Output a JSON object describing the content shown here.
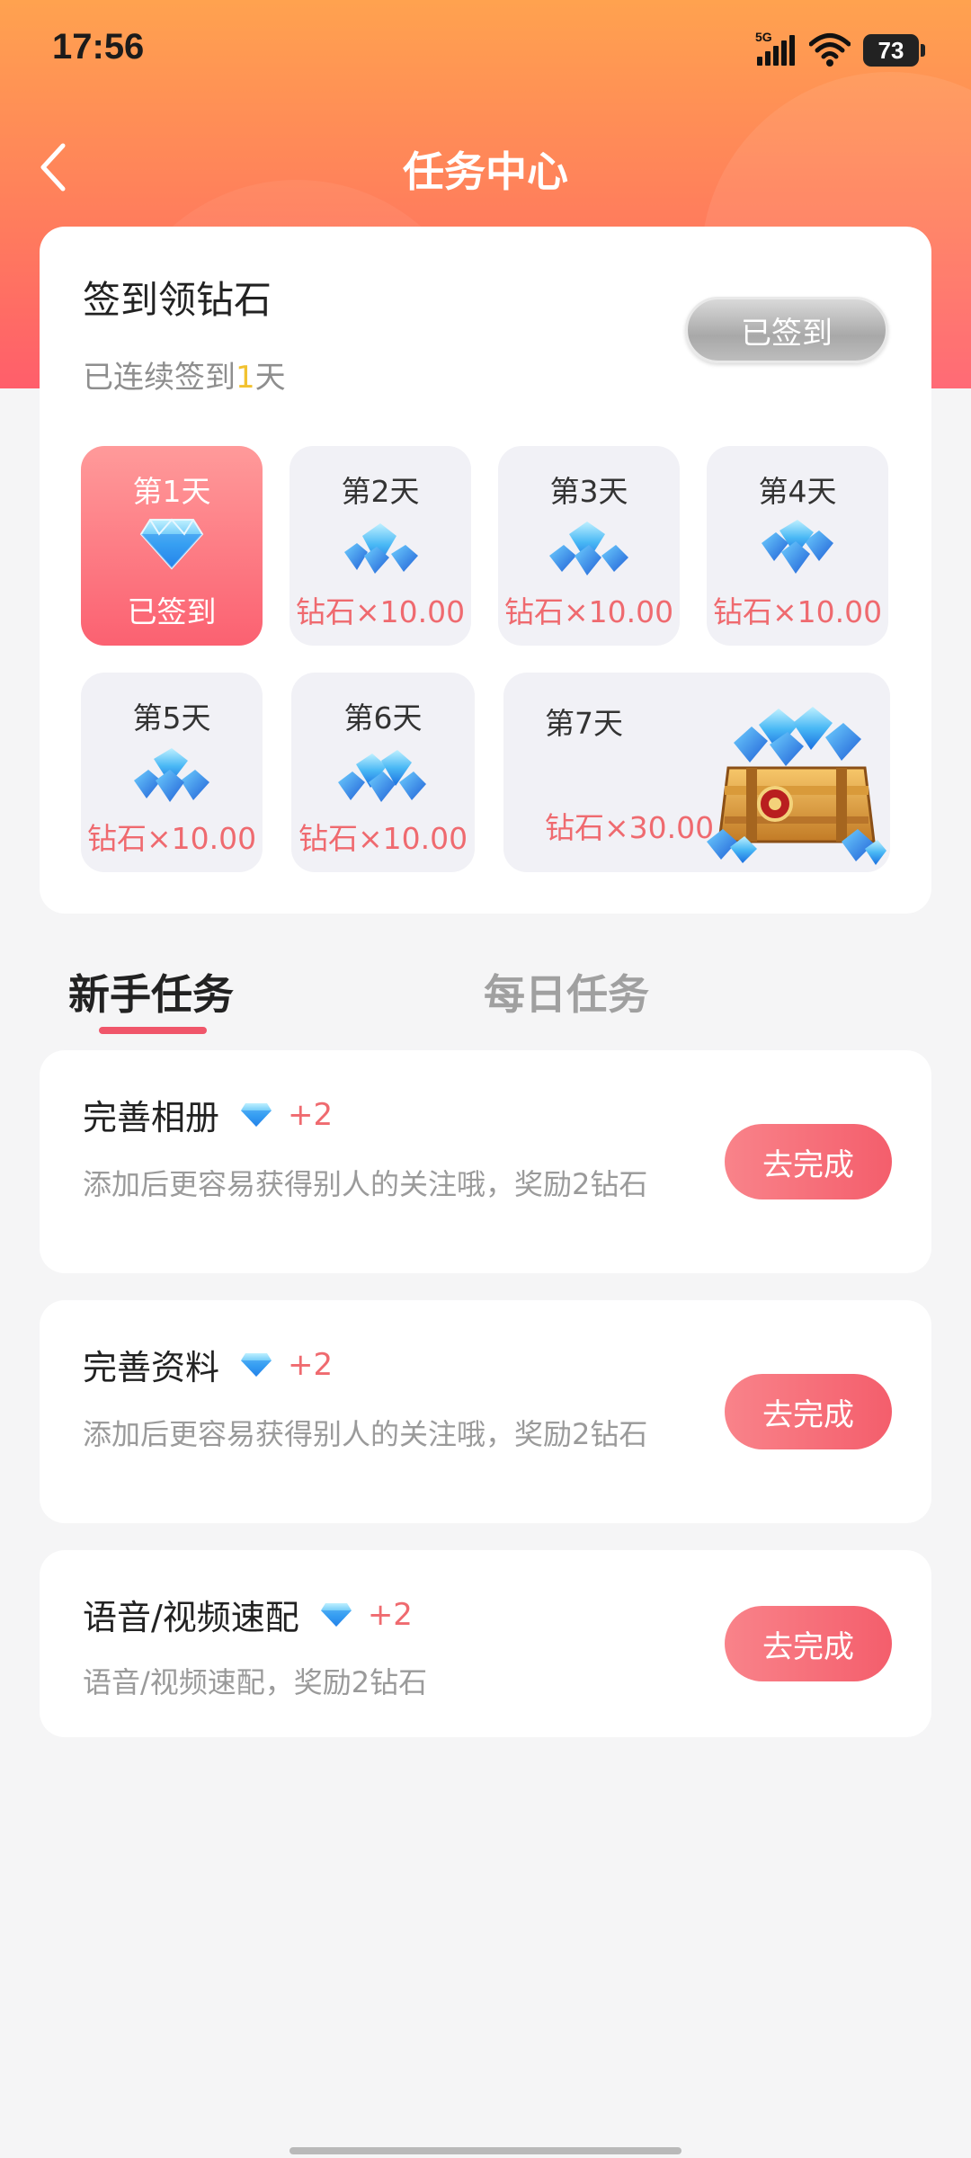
{
  "status_bar": {
    "time": "17:56",
    "network": "5G",
    "battery": "73"
  },
  "nav": {
    "title": "任务中心"
  },
  "signin": {
    "title": "签到领钻石",
    "subtitle_prefix": "已连续签到",
    "subtitle_days": "1",
    "subtitle_suffix": "天",
    "button_label": "已签到",
    "days": [
      {
        "name": "第1天",
        "reward": "已签到",
        "signed": true
      },
      {
        "name": "第2天",
        "reward": "钻石×10.00",
        "signed": false
      },
      {
        "name": "第3天",
        "reward": "钻石×10.00",
        "signed": false
      },
      {
        "name": "第4天",
        "reward": "钻石×10.00",
        "signed": false
      },
      {
        "name": "第5天",
        "reward": "钻石×10.00",
        "signed": false
      },
      {
        "name": "第6天",
        "reward": "钻石×10.00",
        "signed": false
      },
      {
        "name": "第7天",
        "reward": "钻石×30.00",
        "signed": false
      }
    ]
  },
  "tabs": {
    "items": [
      {
        "label": "新手任务",
        "active": true
      },
      {
        "label": "每日任务",
        "active": false
      }
    ]
  },
  "tasks": [
    {
      "title": "完善相册",
      "reward": "+2",
      "desc": "添加后更容易获得别人的关注哦，奖励2钻石",
      "button": "去完成"
    },
    {
      "title": "完善资料",
      "reward": "+2",
      "desc": "添加后更容易获得别人的关注哦，奖励2钻石",
      "button": "去完成"
    },
    {
      "title": "语音/视频速配",
      "reward": "+2",
      "desc": "语音/视频速配，奖励2钻石",
      "button": "去完成"
    }
  ],
  "colors": {
    "accent": "#f45e6c",
    "header_top": "#ffa24f",
    "header_bottom": "#ff5e6b",
    "highlight": "#f2c230"
  }
}
